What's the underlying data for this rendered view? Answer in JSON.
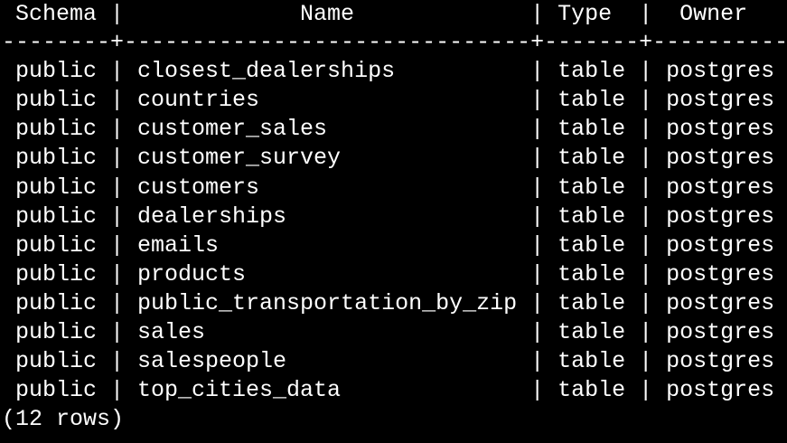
{
  "psql": {
    "header": {
      "schema": "Schema",
      "name": "Name",
      "type": "Type",
      "owner": "Owner"
    },
    "rows": [
      {
        "schema": "public",
        "name": "closest_dealerships",
        "type": "table",
        "owner": "postgres"
      },
      {
        "schema": "public",
        "name": "countries",
        "type": "table",
        "owner": "postgres"
      },
      {
        "schema": "public",
        "name": "customer_sales",
        "type": "table",
        "owner": "postgres"
      },
      {
        "schema": "public",
        "name": "customer_survey",
        "type": "table",
        "owner": "postgres"
      },
      {
        "schema": "public",
        "name": "customers",
        "type": "table",
        "owner": "postgres"
      },
      {
        "schema": "public",
        "name": "dealerships",
        "type": "table",
        "owner": "postgres"
      },
      {
        "schema": "public",
        "name": "emails",
        "type": "table",
        "owner": "postgres"
      },
      {
        "schema": "public",
        "name": "products",
        "type": "table",
        "owner": "postgres"
      },
      {
        "schema": "public",
        "name": "public_transportation_by_zip",
        "type": "table",
        "owner": "postgres"
      },
      {
        "schema": "public",
        "name": "sales",
        "type": "table",
        "owner": "postgres"
      },
      {
        "schema": "public",
        "name": "salespeople",
        "type": "table",
        "owner": "postgres"
      },
      {
        "schema": "public",
        "name": "top_cities_data",
        "type": "table",
        "owner": "postgres"
      }
    ],
    "footer": "(12 rows)"
  }
}
